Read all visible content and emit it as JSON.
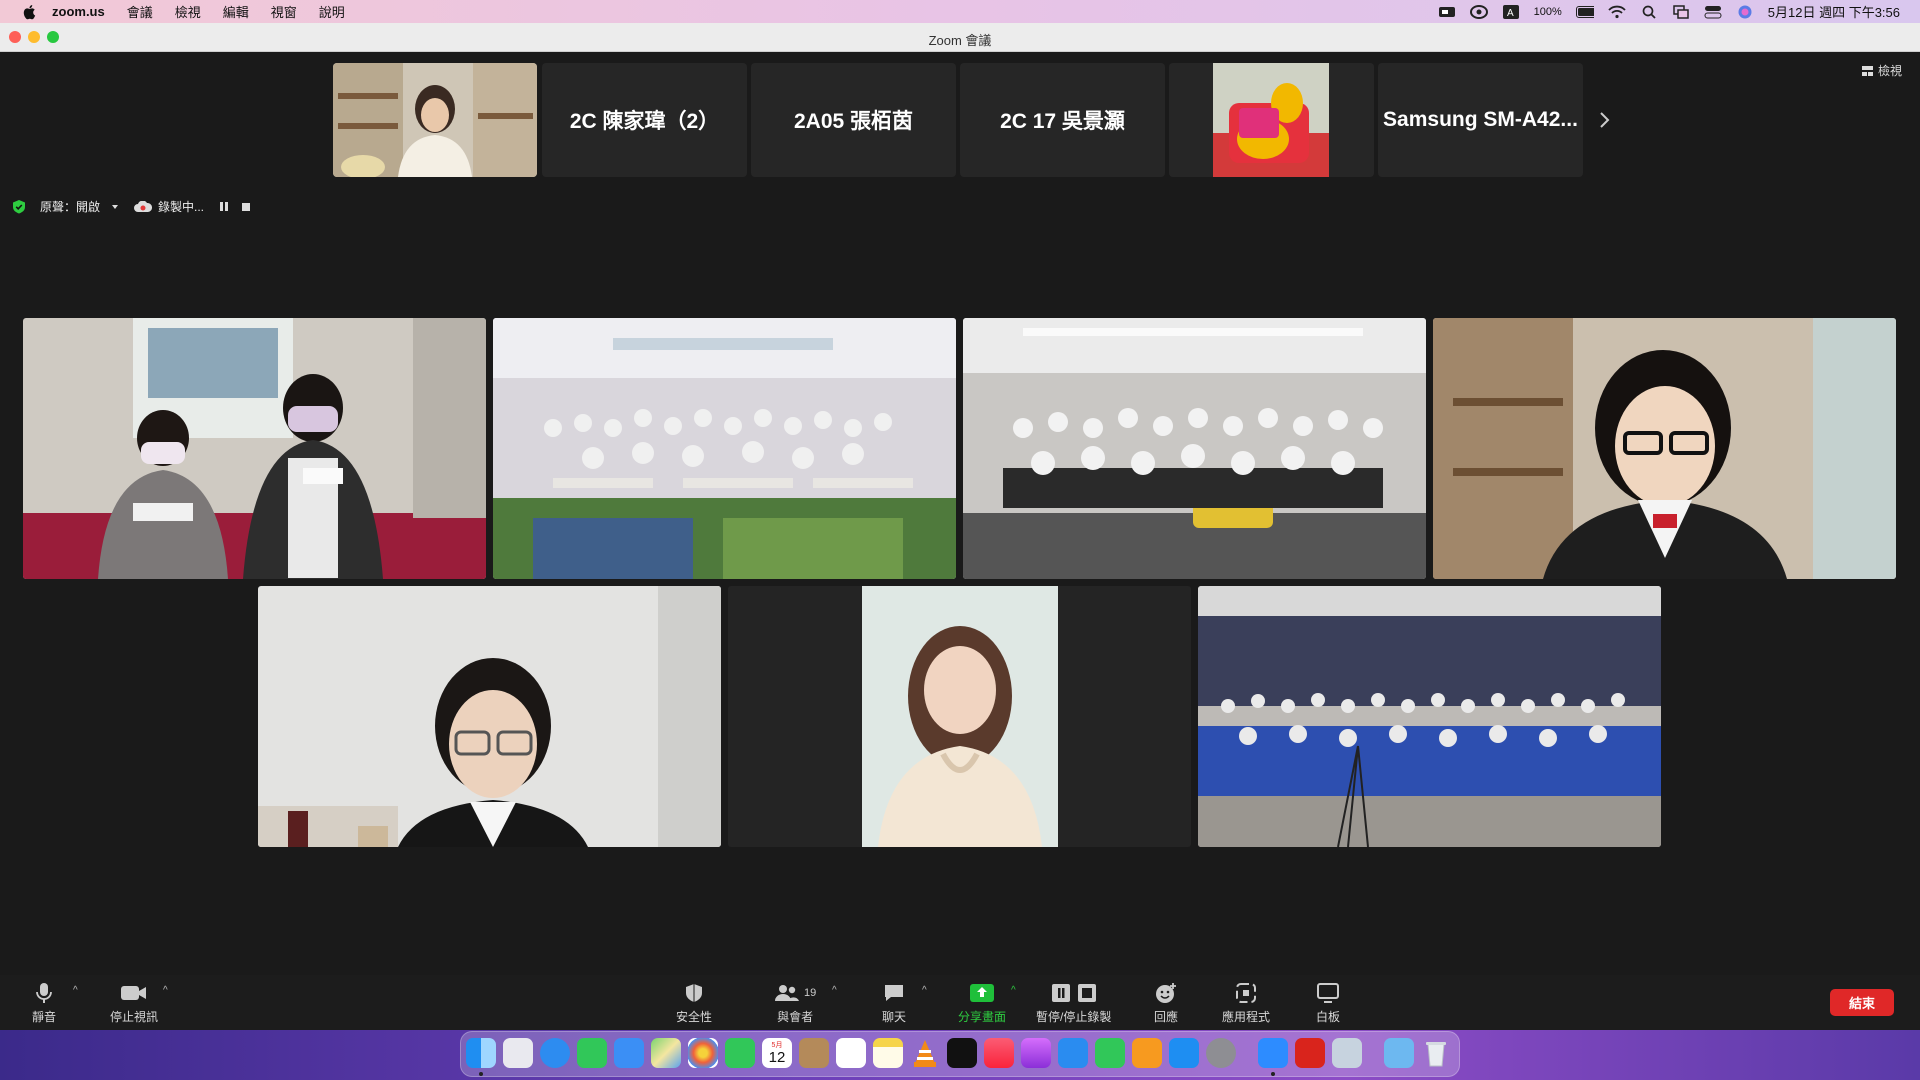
{
  "menubar": {
    "app_name": "zoom.us",
    "items": [
      "會議",
      "檢視",
      "編輯",
      "視窗",
      "說明"
    ],
    "battery": "100%",
    "clock": "5月12日 週四 下午3:56"
  },
  "window": {
    "title": "Zoom 會議"
  },
  "view_button": "檢視",
  "thumbnails": [
    {
      "label": ""
    },
    {
      "label": "2C 陳家瑋（2）"
    },
    {
      "label": "2A05 張栢茵"
    },
    {
      "label": "2C 17 吳景灝"
    },
    {
      "label": ""
    },
    {
      "label": "Samsung SM-A42..."
    }
  ],
  "status": {
    "original_sound": "原聲：開啟",
    "recording": "錄製中..."
  },
  "toolbar": {
    "mute": "靜音",
    "stop_video": "停止視訊",
    "security": "安全性",
    "participants": "與會者",
    "participant_count": "19",
    "chat": "聊天",
    "share_screen": "分享畫面",
    "pause_stop_recording": "暫停/停止錄製",
    "reactions": "回應",
    "apps": "應用程式",
    "whiteboard": "白板",
    "end": "結束"
  },
  "dock": {
    "calendar_day": "12",
    "calendar_month": "5月"
  },
  "colors": {
    "accent_green": "#2ecc40",
    "end_red": "#e02828",
    "share_green": "#1fbf3a"
  }
}
